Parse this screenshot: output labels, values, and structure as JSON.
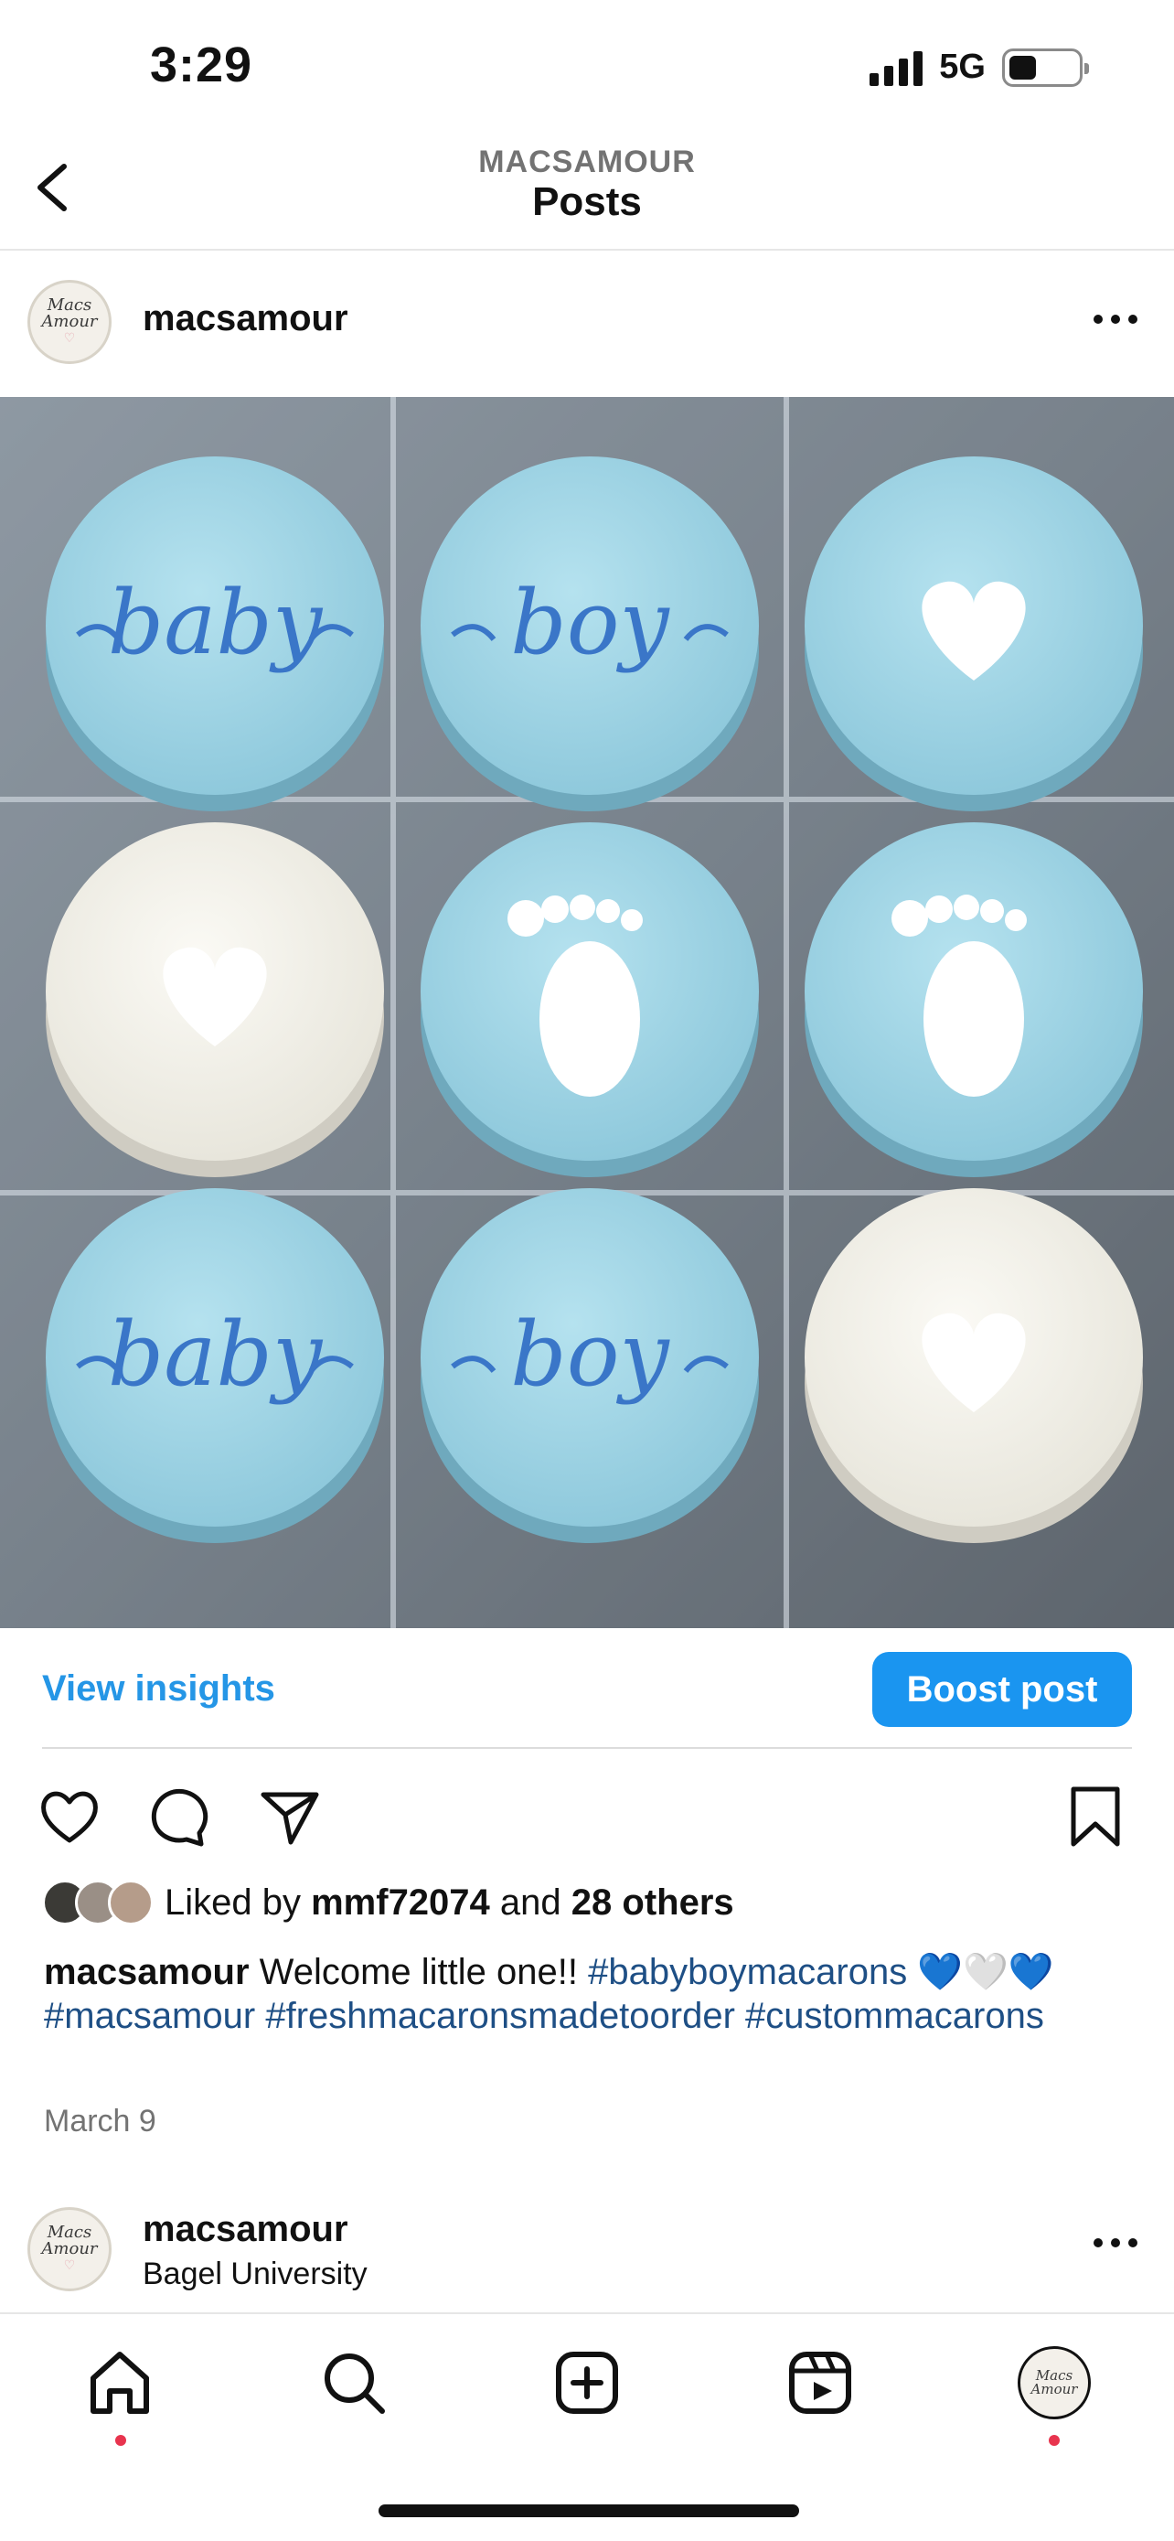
{
  "status_bar": {
    "time": "3:29",
    "network": "5G",
    "battery_percent": 40
  },
  "header": {
    "subtitle": "MACSAMOUR",
    "title": "Posts",
    "back_icon": "chevron-left-icon"
  },
  "post": {
    "username": "macsamour",
    "avatar_text": [
      "Macs",
      "Amour",
      "♡"
    ],
    "more_icon": "more-horizontal-icon",
    "image_content": {
      "macarons": [
        {
          "color": "blue",
          "decoration": "baby"
        },
        {
          "color": "blue",
          "decoration": "boy"
        },
        {
          "color": "blue",
          "decoration": "heart"
        },
        {
          "color": "white",
          "decoration": "heart"
        },
        {
          "color": "blue",
          "decoration": "footprint"
        },
        {
          "color": "blue",
          "decoration": "footprint"
        },
        {
          "color": "blue",
          "decoration": "baby"
        },
        {
          "color": "blue",
          "decoration": "boy"
        },
        {
          "color": "white",
          "decoration": "heart"
        }
      ]
    },
    "view_insights": "View insights",
    "boost_post": "Boost post",
    "actions": [
      "heart-icon",
      "comment-icon",
      "share-icon",
      "bookmark-icon"
    ],
    "likes": {
      "prefix": "Liked by ",
      "user": "mmf72074",
      "middle": " and ",
      "others": "28 others"
    },
    "caption": {
      "user": "macsamour",
      "text": " Welcome little one!! ",
      "tag1": "#babyboymacarons",
      "emoji": " 💙🤍💙 ",
      "tag2": "#macsamour",
      "tag3": "#freshmacaronsmadetoorder",
      "tag4": "#custommacarons"
    },
    "date": "March 9"
  },
  "next_post": {
    "username": "macsamour",
    "location": "Bagel University"
  },
  "tab_bar": [
    "home-icon",
    "search-icon",
    "create-icon",
    "reels-icon",
    "profile-avatar"
  ],
  "colors": {
    "accent": "#1a95f0",
    "hashtag": "#1e4f85",
    "macaron_blue": "#9fd4e4",
    "macaron_white": "#f4f2ea"
  }
}
